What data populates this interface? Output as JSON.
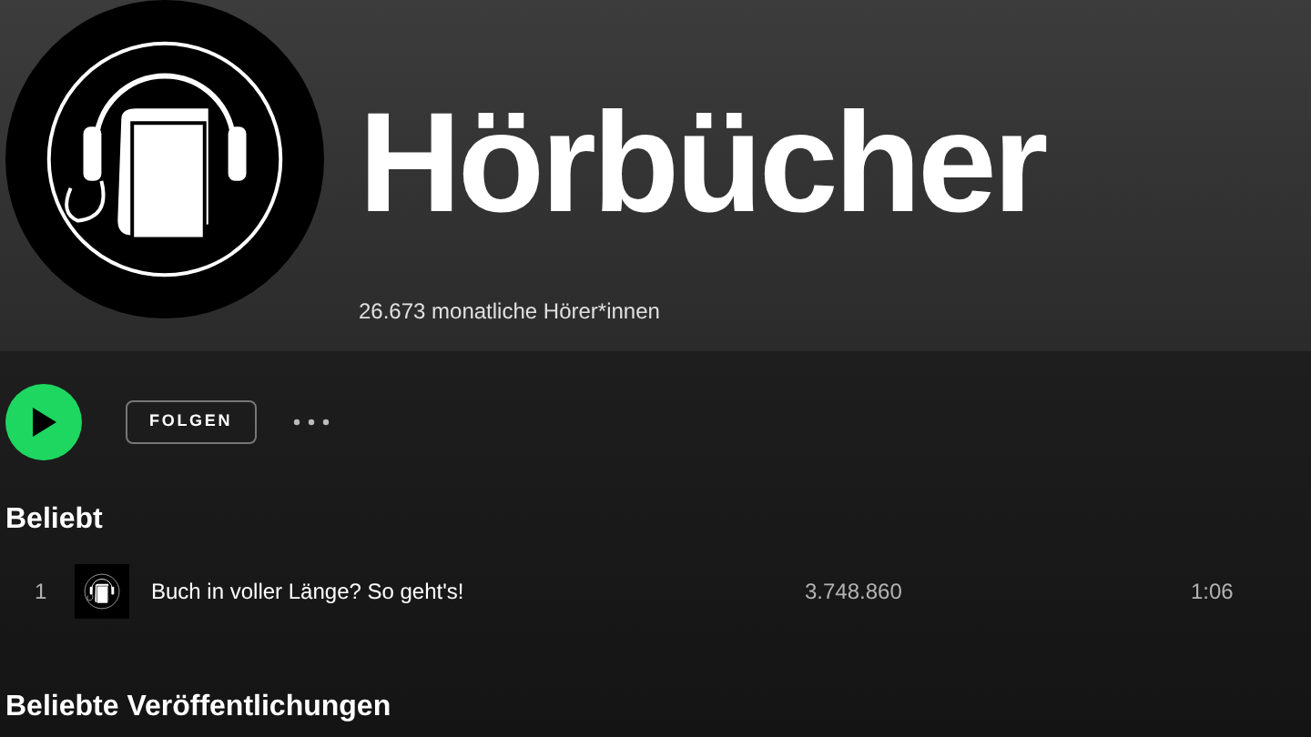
{
  "artist": {
    "name": "Hörbücher",
    "monthly_listeners": "26.673 monatliche Hörer*innen"
  },
  "actions": {
    "follow": "FOLGEN"
  },
  "popular": {
    "heading": "Beliebt",
    "tracks": [
      {
        "number": "1",
        "title": "Buch in voller Länge? So geht's!",
        "plays": "3.748.860",
        "duration": "1:06"
      }
    ]
  },
  "releases": {
    "heading": "Beliebte Veröffentlichungen"
  }
}
